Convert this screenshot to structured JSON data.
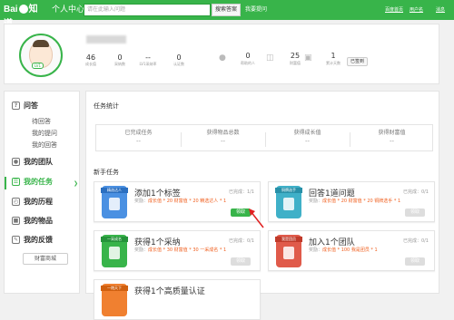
{
  "header": {
    "logo_text": "Bai",
    "logo_suffix": "知道",
    "nav_label": "个人中心",
    "search_placeholder": "请在此输入问题",
    "search_button": "搜索答案",
    "ask_button": "我要提问",
    "right_links": [
      "百度首页",
      "用户名",
      "消息"
    ]
  },
  "profile": {
    "level_badge": "LV1",
    "stats": [
      {
        "value": "46",
        "label": "成长值"
      },
      {
        "value": "0",
        "label": "采纳数"
      },
      {
        "value": "--",
        "label": "LV1采纳率"
      },
      {
        "value": "0",
        "label": "认证数"
      }
    ],
    "icon_stats": [
      {
        "icon": "person-icon",
        "value": "0",
        "label": "帮助的人"
      },
      {
        "icon": "wealth-icon",
        "value": "25",
        "label": "财富值"
      },
      {
        "icon": "calendar-icon",
        "value": "1",
        "label": "累计天数"
      }
    ],
    "signed_button": "已签到"
  },
  "sidebar": {
    "groups": [
      {
        "icon": "question-icon",
        "label": "问答",
        "subs": [
          "待回答",
          "我的提问",
          "我的回答"
        ]
      },
      {
        "icon": "team-icon",
        "label": "我的团队"
      },
      {
        "icon": "task-icon",
        "label": "我的任务",
        "active": true
      },
      {
        "icon": "history-icon",
        "label": "我的历程"
      },
      {
        "icon": "items-icon",
        "label": "我的物品"
      },
      {
        "icon": "feedback-icon",
        "label": "我的反馈"
      }
    ],
    "fortune_button": "财富商城"
  },
  "main": {
    "stats_title": "任务统计",
    "stats": [
      {
        "label": "已完成任务",
        "value": "--"
      },
      {
        "label": "获得物品总数",
        "value": "--"
      },
      {
        "label": "获得成长值",
        "value": "--"
      },
      {
        "label": "获得财富值",
        "value": "--"
      }
    ],
    "newbie_title": "新手任务",
    "cards": [
      {
        "tag": "精选达人",
        "badge_color": "#4a90e2",
        "title": "添加1个标签",
        "progress": "已完成：1/1",
        "reward_prefix": "奖励：",
        "reward": "成长值 * 20  财富值 * 20  精选达人 * 1",
        "button": "领取",
        "enabled": true
      },
      {
        "tag": "铜牌选手",
        "badge_color": "#3fb0c8",
        "title": "回答1道问题",
        "progress": "已完成：0/1",
        "reward_prefix": "奖励：",
        "reward": "成长值 * 20  财富值 * 20  铜牌选手 * 1",
        "button": "领取",
        "enabled": false
      },
      {
        "tag": "一采成名",
        "badge_color": "#38b44a",
        "title": "获得1个采纳",
        "progress": "已完成：0/1",
        "reward_prefix": "奖励：",
        "reward": "成长值 * 30  财富值 * 30  一采成名 * 1",
        "button": "领取",
        "enabled": false
      },
      {
        "tag": "我是团员",
        "badge_color": "#e05a4a",
        "title": "加入1个团队",
        "progress": "已完成：0/1",
        "reward_prefix": "奖励：",
        "reward": "成长值 * 100  我是团员 * 1",
        "button": "领取",
        "enabled": false
      },
      {
        "tag": "一炮天下",
        "badge_color": "#f08030",
        "title": "获得1个高质量认证",
        "progress": "",
        "reward_prefix": "",
        "reward": "",
        "button": "",
        "enabled": false
      }
    ]
  }
}
